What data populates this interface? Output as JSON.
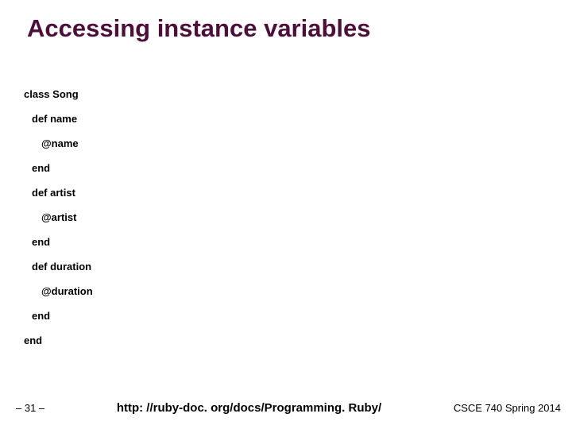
{
  "title": "Accessing instance variables",
  "code": {
    "l0": "class Song",
    "l1": "def name",
    "l2": "@name",
    "l3": "end",
    "l4": "def artist",
    "l5": "@artist",
    "l6": "end",
    "l7": "def duration",
    "l8": "@duration",
    "l9": "end",
    "l10": "end"
  },
  "footer": {
    "page": "– 31 –",
    "link": "http: //ruby-doc. org/docs/Programming. Ruby/",
    "course": "CSCE 740 Spring 2014"
  }
}
